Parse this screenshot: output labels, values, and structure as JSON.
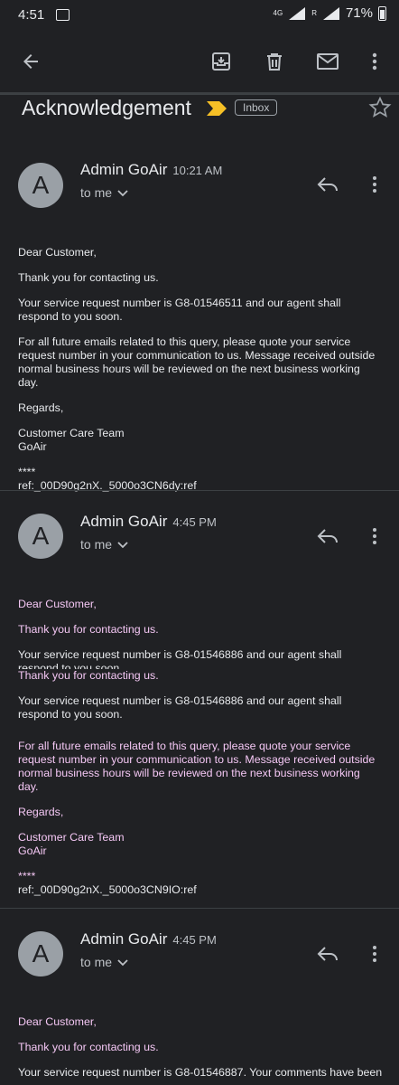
{
  "status": {
    "time": "4:51",
    "network": "4G",
    "roaming": "R",
    "battery": "71%"
  },
  "toolbar": {
    "back": "arrow-back-icon",
    "archive": "archive-icon",
    "delete": "delete-icon",
    "mark_unread": "mail-icon",
    "more": "more-vert-icon"
  },
  "subject": {
    "title": "Acknowledgement",
    "label": "Inbox"
  },
  "messages": [
    {
      "avatar": "A",
      "sender": "Admin GoAir",
      "time": "10:21 AM",
      "to": "to me",
      "lines": {
        "greeting": "Dear Customer,",
        "thanks": "Thank you for contacting us.",
        "service": "Your service request number is G8-01546511 and our agent shall respond to you soon.",
        "future": "For all future emails related to this query, please quote your service request number in your communication to us. Message received outside normal business hours will be reviewed on the next business working day.",
        "regards": "Regards,",
        "team": "Customer Care Team",
        "company": "GoAir",
        "stars": "****",
        "ref": "ref:_00D90g2nX._5000o3CN6dy:ref"
      }
    },
    {
      "avatar": "A",
      "sender": "Admin GoAir",
      "time": "4:45 PM",
      "to": "to me",
      "lines": {
        "greeting": "Dear Customer,",
        "thanks": "Thank you for contacting us.",
        "service": "Your service request number is G8-01546886 and our agent shall respond to you soon.",
        "thanks2": "Thank you for contacting us.",
        "service2": "Your service request number is G8-01546886 and our agent shall respond to you soon.",
        "future": "For all future emails related to this query, please quote your service request number in your communication to us. Message received outside normal business hours will be reviewed on the next business working day.",
        "regards": "Regards,",
        "team": "Customer Care Team",
        "company": "GoAir",
        "stars": "****",
        "ref": "ref:_00D90g2nX._5000o3CN9IO:ref"
      }
    },
    {
      "avatar": "A",
      "sender": "Admin GoAir",
      "time": "4:45 PM",
      "to": "to me",
      "lines": {
        "greeting": "Dear Customer,",
        "thanks": "Thank you for contacting us.",
        "service": "Your service request number is  G8-01546887. Your comments have been"
      }
    }
  ]
}
